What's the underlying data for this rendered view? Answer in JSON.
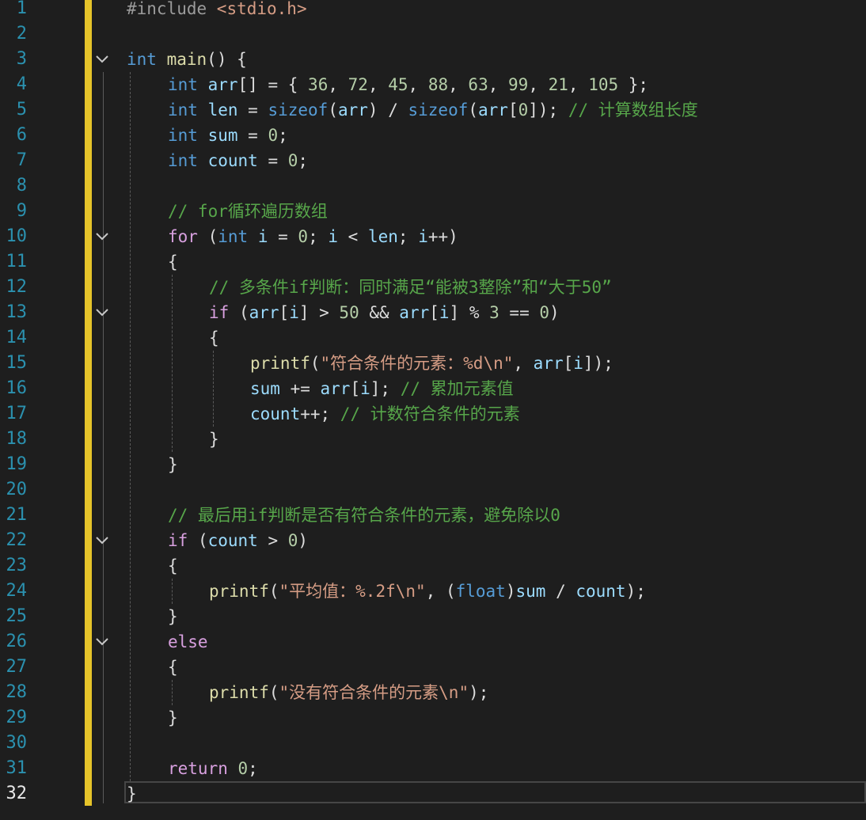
{
  "editor": {
    "current_line": 32,
    "fold_lines": [
      3,
      10,
      13,
      22,
      26
    ],
    "lines": [
      {
        "n": "1",
        "indent": 0,
        "tokens": [
          [
            "pre",
            "#include "
          ],
          [
            "str",
            "<stdio.h>"
          ]
        ]
      },
      {
        "n": "2",
        "indent": 0,
        "tokens": []
      },
      {
        "n": "3",
        "indent": 0,
        "tokens": [
          [
            "kw",
            "int"
          ],
          [
            "txt",
            " "
          ],
          [
            "fn",
            "main"
          ],
          [
            "txt",
            "() {"
          ]
        ]
      },
      {
        "n": "4",
        "indent": 1,
        "tokens": [
          [
            "kw",
            "int"
          ],
          [
            "txt",
            " "
          ],
          [
            "var",
            "arr"
          ],
          [
            "txt",
            "[] = { "
          ],
          [
            "num",
            "36"
          ],
          [
            "txt",
            ", "
          ],
          [
            "num",
            "72"
          ],
          [
            "txt",
            ", "
          ],
          [
            "num",
            "45"
          ],
          [
            "txt",
            ", "
          ],
          [
            "num",
            "88"
          ],
          [
            "txt",
            ", "
          ],
          [
            "num",
            "63"
          ],
          [
            "txt",
            ", "
          ],
          [
            "num",
            "99"
          ],
          [
            "txt",
            ", "
          ],
          [
            "num",
            "21"
          ],
          [
            "txt",
            ", "
          ],
          [
            "num",
            "105"
          ],
          [
            "txt",
            " };"
          ]
        ]
      },
      {
        "n": "5",
        "indent": 1,
        "tokens": [
          [
            "kw",
            "int"
          ],
          [
            "txt",
            " "
          ],
          [
            "var",
            "len"
          ],
          [
            "txt",
            " = "
          ],
          [
            "kw",
            "sizeof"
          ],
          [
            "txt",
            "("
          ],
          [
            "var",
            "arr"
          ],
          [
            "txt",
            ") / "
          ],
          [
            "kw",
            "sizeof"
          ],
          [
            "txt",
            "("
          ],
          [
            "var",
            "arr"
          ],
          [
            "txt",
            "["
          ],
          [
            "num",
            "0"
          ],
          [
            "txt",
            "]); "
          ],
          [
            "com",
            "// 计算数组长度"
          ]
        ]
      },
      {
        "n": "6",
        "indent": 1,
        "tokens": [
          [
            "kw",
            "int"
          ],
          [
            "txt",
            " "
          ],
          [
            "var",
            "sum"
          ],
          [
            "txt",
            " = "
          ],
          [
            "num",
            "0"
          ],
          [
            "txt",
            ";"
          ]
        ]
      },
      {
        "n": "7",
        "indent": 1,
        "tokens": [
          [
            "kw",
            "int"
          ],
          [
            "txt",
            " "
          ],
          [
            "var",
            "count"
          ],
          [
            "txt",
            " = "
          ],
          [
            "num",
            "0"
          ],
          [
            "txt",
            ";"
          ]
        ]
      },
      {
        "n": "8",
        "indent": 1,
        "tokens": []
      },
      {
        "n": "9",
        "indent": 1,
        "tokens": [
          [
            "com",
            "// for循环遍历数组"
          ]
        ]
      },
      {
        "n": "10",
        "indent": 1,
        "tokens": [
          [
            "ctl",
            "for"
          ],
          [
            "txt",
            " ("
          ],
          [
            "kw",
            "int"
          ],
          [
            "txt",
            " "
          ],
          [
            "var",
            "i"
          ],
          [
            "txt",
            " = "
          ],
          [
            "num",
            "0"
          ],
          [
            "txt",
            "; "
          ],
          [
            "var",
            "i"
          ],
          [
            "txt",
            " < "
          ],
          [
            "var",
            "len"
          ],
          [
            "txt",
            "; "
          ],
          [
            "var",
            "i"
          ],
          [
            "txt",
            "++)"
          ]
        ]
      },
      {
        "n": "11",
        "indent": 1,
        "tokens": [
          [
            "txt",
            "{"
          ]
        ]
      },
      {
        "n": "12",
        "indent": 2,
        "tokens": [
          [
            "com",
            "// 多条件if判断：同时满足“能被3整除”和“大于50”"
          ]
        ]
      },
      {
        "n": "13",
        "indent": 2,
        "tokens": [
          [
            "ctl",
            "if"
          ],
          [
            "txt",
            " ("
          ],
          [
            "var",
            "arr"
          ],
          [
            "txt",
            "["
          ],
          [
            "var",
            "i"
          ],
          [
            "txt",
            "] > "
          ],
          [
            "num",
            "50"
          ],
          [
            "txt",
            " && "
          ],
          [
            "var",
            "arr"
          ],
          [
            "txt",
            "["
          ],
          [
            "var",
            "i"
          ],
          [
            "txt",
            "] % "
          ],
          [
            "num",
            "3"
          ],
          [
            "txt",
            " == "
          ],
          [
            "num",
            "0"
          ],
          [
            "txt",
            ")"
          ]
        ]
      },
      {
        "n": "14",
        "indent": 2,
        "tokens": [
          [
            "txt",
            "{"
          ]
        ]
      },
      {
        "n": "15",
        "indent": 3,
        "tokens": [
          [
            "fn",
            "printf"
          ],
          [
            "txt",
            "("
          ],
          [
            "str",
            "\"符合条件的元素：%d\\n\""
          ],
          [
            "txt",
            ", "
          ],
          [
            "var",
            "arr"
          ],
          [
            "txt",
            "["
          ],
          [
            "var",
            "i"
          ],
          [
            "txt",
            "]);"
          ]
        ]
      },
      {
        "n": "16",
        "indent": 3,
        "tokens": [
          [
            "var",
            "sum"
          ],
          [
            "txt",
            " += "
          ],
          [
            "var",
            "arr"
          ],
          [
            "txt",
            "["
          ],
          [
            "var",
            "i"
          ],
          [
            "txt",
            "]; "
          ],
          [
            "com",
            "// 累加元素值"
          ]
        ]
      },
      {
        "n": "17",
        "indent": 3,
        "tokens": [
          [
            "var",
            "count"
          ],
          [
            "txt",
            "++; "
          ],
          [
            "com",
            "// 计数符合条件的元素"
          ]
        ]
      },
      {
        "n": "18",
        "indent": 2,
        "tokens": [
          [
            "txt",
            "}"
          ]
        ]
      },
      {
        "n": "19",
        "indent": 1,
        "tokens": [
          [
            "txt",
            "}"
          ]
        ]
      },
      {
        "n": "20",
        "indent": 1,
        "tokens": []
      },
      {
        "n": "21",
        "indent": 1,
        "tokens": [
          [
            "com",
            "// 最后用if判断是否有符合条件的元素，避免除以0"
          ]
        ]
      },
      {
        "n": "22",
        "indent": 1,
        "tokens": [
          [
            "ctl",
            "if"
          ],
          [
            "txt",
            " ("
          ],
          [
            "var",
            "count"
          ],
          [
            "txt",
            " > "
          ],
          [
            "num",
            "0"
          ],
          [
            "txt",
            ")"
          ]
        ]
      },
      {
        "n": "23",
        "indent": 1,
        "tokens": [
          [
            "txt",
            "{"
          ]
        ]
      },
      {
        "n": "24",
        "indent": 2,
        "tokens": [
          [
            "fn",
            "printf"
          ],
          [
            "txt",
            "("
          ],
          [
            "str",
            "\"平均值：%.2f\\n\""
          ],
          [
            "txt",
            ", ("
          ],
          [
            "kw",
            "float"
          ],
          [
            "txt",
            ")"
          ],
          [
            "var",
            "sum"
          ],
          [
            "txt",
            " / "
          ],
          [
            "var",
            "count"
          ],
          [
            "txt",
            ");"
          ]
        ]
      },
      {
        "n": "25",
        "indent": 1,
        "tokens": [
          [
            "txt",
            "}"
          ]
        ]
      },
      {
        "n": "26",
        "indent": 1,
        "tokens": [
          [
            "ctl",
            "else"
          ]
        ]
      },
      {
        "n": "27",
        "indent": 1,
        "tokens": [
          [
            "txt",
            "{"
          ]
        ]
      },
      {
        "n": "28",
        "indent": 2,
        "tokens": [
          [
            "fn",
            "printf"
          ],
          [
            "txt",
            "("
          ],
          [
            "str",
            "\"没有符合条件的元素\\n\""
          ],
          [
            "txt",
            ");"
          ]
        ]
      },
      {
        "n": "29",
        "indent": 1,
        "tokens": [
          [
            "txt",
            "}"
          ]
        ]
      },
      {
        "n": "30",
        "indent": 1,
        "tokens": []
      },
      {
        "n": "31",
        "indent": 1,
        "tokens": [
          [
            "ctl",
            "return"
          ],
          [
            "txt",
            " "
          ],
          [
            "num",
            "0"
          ],
          [
            "txt",
            ";"
          ]
        ]
      },
      {
        "n": "32",
        "indent": 0,
        "tokens": [
          [
            "txt",
            "}"
          ]
        ]
      }
    ]
  },
  "colors": {
    "background": "#1e1e1e",
    "keyword": "#569cd6",
    "control": "#d8a0df",
    "comment": "#57a64a",
    "string": "#d69d85",
    "number": "#b5cea8",
    "variable": "#9cdcfe",
    "function": "#dcdcaa",
    "line_number": "#2b91af",
    "change_bar": "#e6c42a"
  }
}
